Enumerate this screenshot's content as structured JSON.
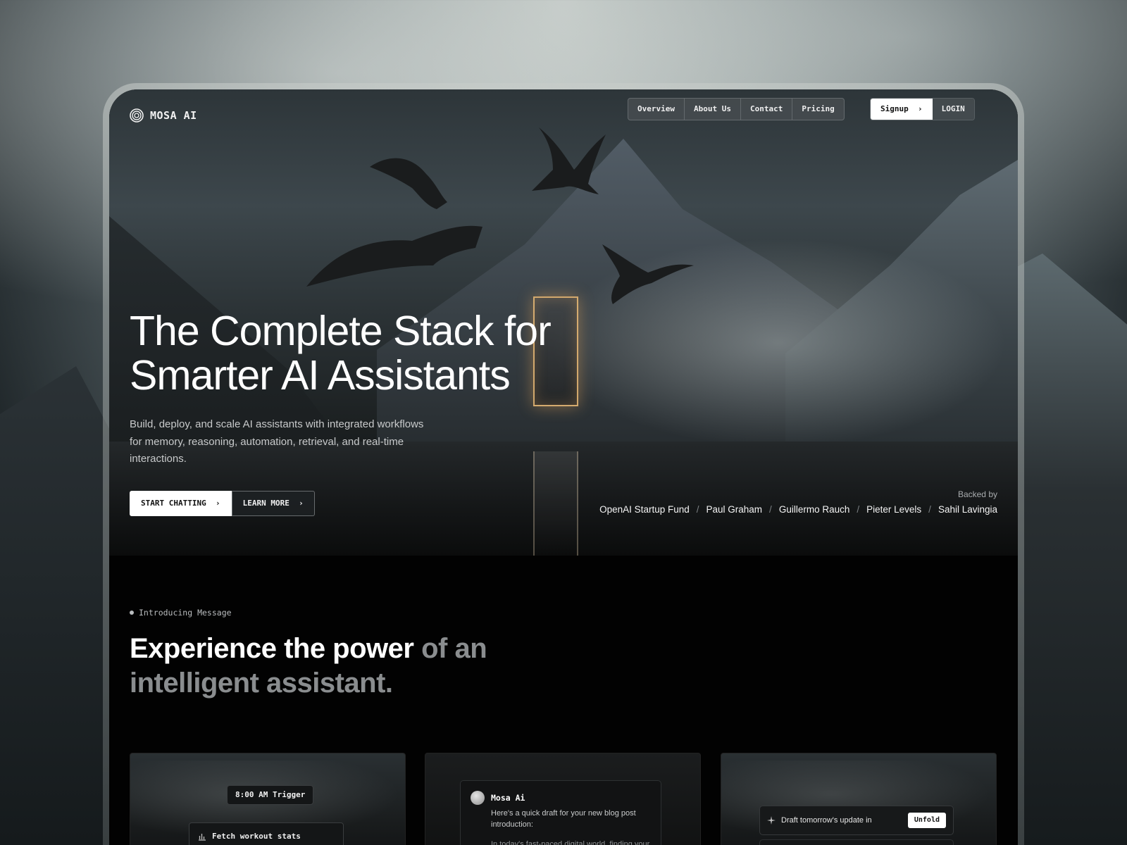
{
  "brand": {
    "name": "MOSA AI",
    "logo_icon": "concentric-circles-icon"
  },
  "nav": {
    "items": [
      {
        "label": "Overview"
      },
      {
        "label": "About Us"
      },
      {
        "label": "Contact"
      },
      {
        "label": "Pricing"
      }
    ],
    "signup_label": "Signup",
    "login_label": "LOGIN"
  },
  "hero": {
    "title_line1": "The Complete Stack for",
    "title_line2": "Smarter AI Assistants",
    "subtitle": "Build, deploy, and scale AI assistants with integrated workflows for memory, reasoning, automation, retrieval, and real-time interactions.",
    "cta_primary": "START CHATTING",
    "cta_secondary": "LEARN MORE",
    "backed_label": "Backed by",
    "backers": [
      "OpenAI Startup Fund",
      "Paul Graham",
      "Guillermo Rauch",
      "Pieter Levels",
      "Sahil Lavingia"
    ],
    "separator": "/"
  },
  "intro": {
    "tag": "Introducing Message",
    "title_strong": "Experience the power",
    "title_muted": "of an intelligent assistant."
  },
  "cards": {
    "card1": {
      "trigger": "8:00 AM Trigger",
      "task": "Fetch workout stats",
      "task_icon": "bar-chart-icon"
    },
    "card2": {
      "name": "Mosa Ai",
      "message": "Here's a quick draft for your new blog post introduction:",
      "excerpt": "In today's fast-paced digital world, finding your"
    },
    "card3": {
      "draft_text": "Draft tomorrow's update in",
      "action": "Unfold",
      "draft_icon": "sparkle-icon"
    }
  },
  "colors": {
    "accent": "#ffffff",
    "background": "#020202",
    "portal_glow": "#f0be78"
  }
}
